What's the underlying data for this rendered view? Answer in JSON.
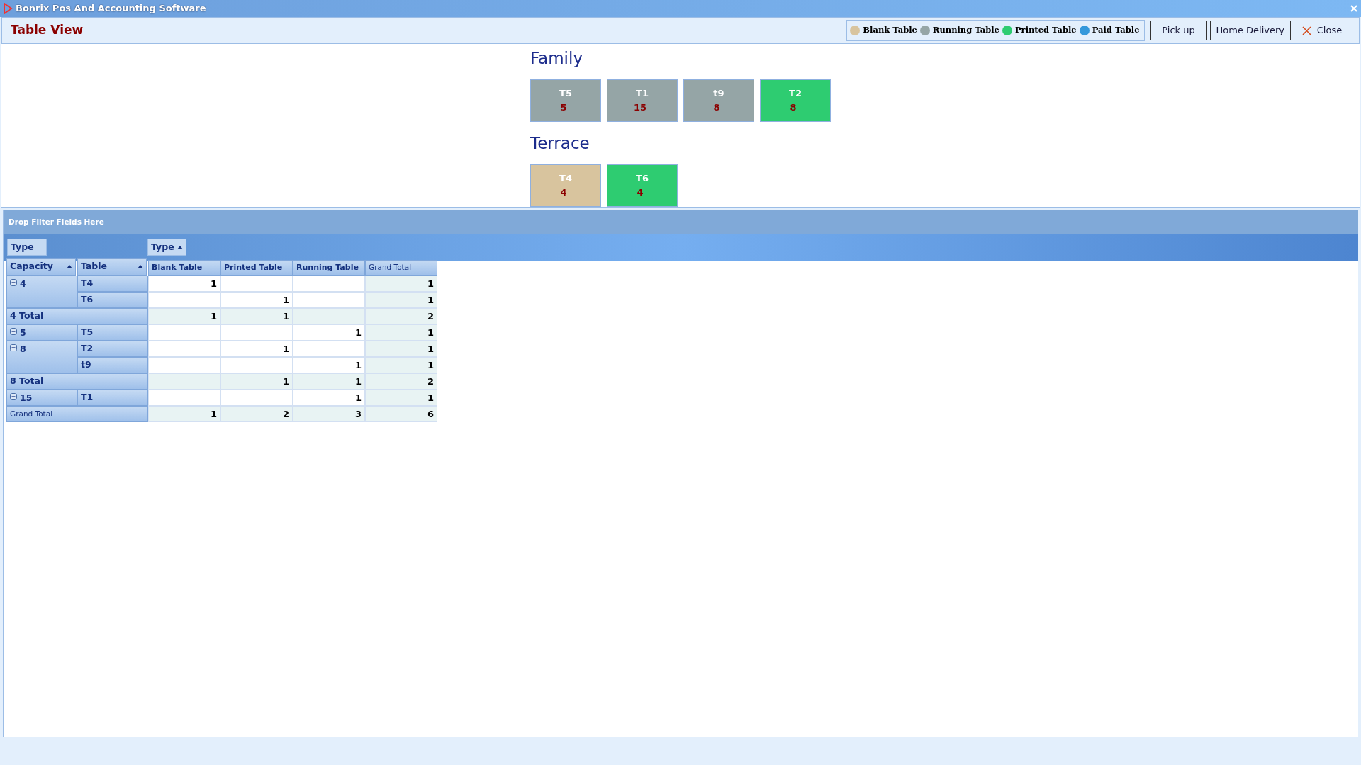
{
  "window": {
    "title": "Bonrix Pos And Accounting Software"
  },
  "header": {
    "title": "Table View"
  },
  "legend": [
    {
      "label": "Blank Table",
      "color": "#d8c49e"
    },
    {
      "label": "Running Table",
      "color": "#95a5a6"
    },
    {
      "label": "Printed Table",
      "color": "#2ecc71"
    },
    {
      "label": "Paid Table",
      "color": "#3498db"
    }
  ],
  "buttons": [
    {
      "label": "Pick up",
      "kind": "plain"
    },
    {
      "label": "Home Delivery",
      "kind": "plain"
    },
    {
      "label": "Close",
      "kind": "close"
    }
  ],
  "sections": [
    {
      "name": "Family",
      "tables": [
        {
          "name": "T5",
          "capacity": "5",
          "color": "#95a5a6"
        },
        {
          "name": "T1",
          "capacity": "15",
          "color": "#95a5a6"
        },
        {
          "name": "t9",
          "capacity": "8",
          "color": "#95a5a6"
        },
        {
          "name": "T2",
          "capacity": "8",
          "color": "#2ecc71"
        }
      ]
    },
    {
      "name": "Terrace",
      "tables": [
        {
          "name": "T4",
          "capacity": "4",
          "color": "#d8c49e"
        },
        {
          "name": "T6",
          "capacity": "4",
          "color": "#2ecc71"
        }
      ]
    }
  ],
  "pivot": {
    "filter_area": "Drop Filter Fields Here",
    "row_area_field": "Type",
    "column_field": "Type",
    "row_fields": [
      "Capacity",
      "Table"
    ],
    "columns": [
      "Blank Table",
      "Printed Table",
      "Running Table",
      "Grand Total"
    ],
    "groups": [
      {
        "capacity": "4",
        "expanded": true,
        "rows": [
          {
            "table": "T4",
            "cells": [
              "1",
              "",
              "",
              "1"
            ]
          },
          {
            "table": "T6",
            "cells": [
              "",
              "1",
              "",
              "1"
            ]
          }
        ],
        "total": {
          "label": "4 Total",
          "cells": [
            "1",
            "1",
            "",
            "2"
          ]
        }
      },
      {
        "capacity": "5",
        "expanded": true,
        "rows": [
          {
            "table": "T5",
            "cells": [
              "",
              "",
              "1",
              "1"
            ]
          }
        ]
      },
      {
        "capacity": "8",
        "expanded": true,
        "rows": [
          {
            "table": "T2",
            "cells": [
              "",
              "1",
              "",
              "1"
            ]
          },
          {
            "table": "t9",
            "cells": [
              "",
              "",
              "1",
              "1"
            ]
          }
        ],
        "total": {
          "label": "8 Total",
          "cells": [
            "",
            "1",
            "1",
            "2"
          ]
        }
      },
      {
        "capacity": "15",
        "expanded": true,
        "rows": [
          {
            "table": "T1",
            "cells": [
              "",
              "",
              "1",
              "1"
            ]
          }
        ]
      }
    ],
    "grand_total": {
      "label": "Grand Total",
      "cells": [
        "1",
        "2",
        "3",
        "6"
      ]
    }
  }
}
